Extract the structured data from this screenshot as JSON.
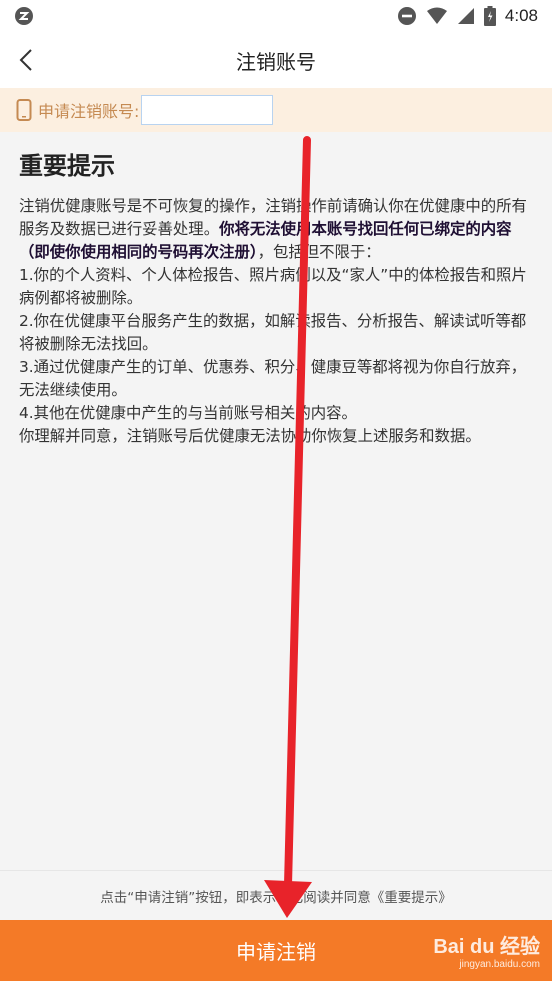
{
  "status_bar": {
    "time": "4:08",
    "icons": [
      "app-notification-icon",
      "do-not-disturb-icon",
      "wifi-icon",
      "signal-icon",
      "battery-icon"
    ]
  },
  "nav": {
    "title": "注销账号",
    "back_icon": "chevron-left-icon"
  },
  "account": {
    "label": "申请注销账号:",
    "value": "",
    "icon": "phone-icon"
  },
  "notice": {
    "title": "重要提示",
    "intro_normal": "注销优健康账号是不可恢复的操作，注销操作前请确认你在优健康中的所有服务及数据已进行妥善处理。",
    "intro_bold": "你将无法使用本账号找回任何已绑定的内容（即使你使用相同的号码再次注册）",
    "intro_tail": "，包括但不限于：",
    "items": [
      "1.你的个人资料、个人体检报告、照片病例以及“家人”中的体检报告和照片病例都将被删除。",
      "2.你在优健康平台服务产生的数据，如解读报告、分析报告、解读试听等都将被删除无法找回。",
      "3.通过优健康产生的订单、优惠券、积分、健康豆等都将视为你自行放弃，无法继续使用。",
      "4.其他在优健康中产生的与当前账号相关的内容。"
    ],
    "closing": "你理解并同意，注销账号后优健康无法协助你恢复上述服务和数据。"
  },
  "footer": {
    "hint": "点击“申请注销”按钮，即表示你已阅读并同意《重要提示》",
    "button_label": "申请注销"
  },
  "watermark": {
    "main": "Bai du 经验",
    "sub": "jingyan.baidu.com"
  },
  "colors": {
    "accent": "#f47a27",
    "account_bar_bg": "#fcefe0",
    "account_label": "#c58a52",
    "annotation_arrow": "#e8232a"
  }
}
